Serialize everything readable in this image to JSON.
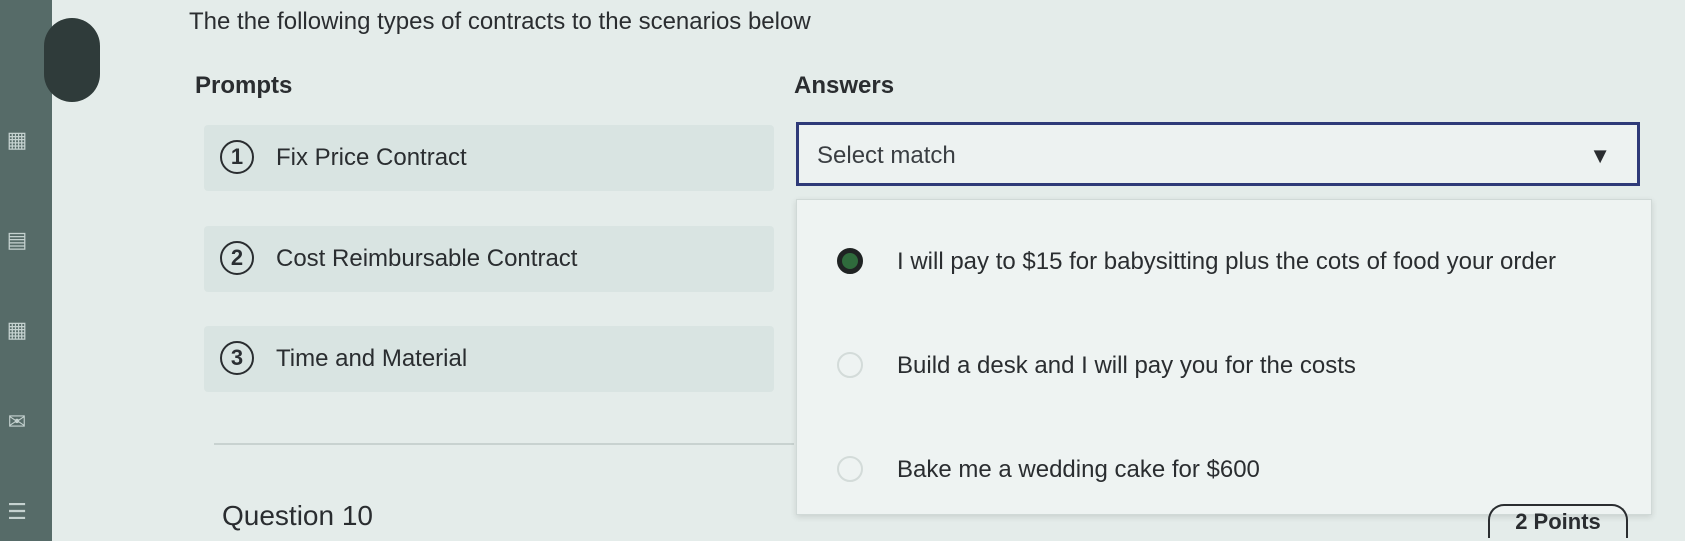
{
  "instructions": "The the following types of contracts to the scenarios below",
  "columns": {
    "prompts": "Prompts",
    "answers": "Answers"
  },
  "prompts": [
    {
      "number": "1",
      "label": "Fix Price Contract"
    },
    {
      "number": "2",
      "label": "Cost Reimbursable Contract"
    },
    {
      "number": "3",
      "label": "Time and Material"
    }
  ],
  "select": {
    "value": "Select match",
    "caret_icon": "dropdown-caret-icon"
  },
  "options": [
    {
      "label": "I will pay to $15 for babysitting plus the cots of food your order",
      "selected": true
    },
    {
      "label": "Build a desk and I will pay you for the costs",
      "selected": false
    },
    {
      "label": "Bake me a wedding cake for $600",
      "selected": false
    }
  ],
  "footer": {
    "question": "Question 10",
    "points": "2 Points"
  },
  "colors": {
    "select_border": "#2e3a78",
    "selected_radio": "#2f6b3c"
  }
}
